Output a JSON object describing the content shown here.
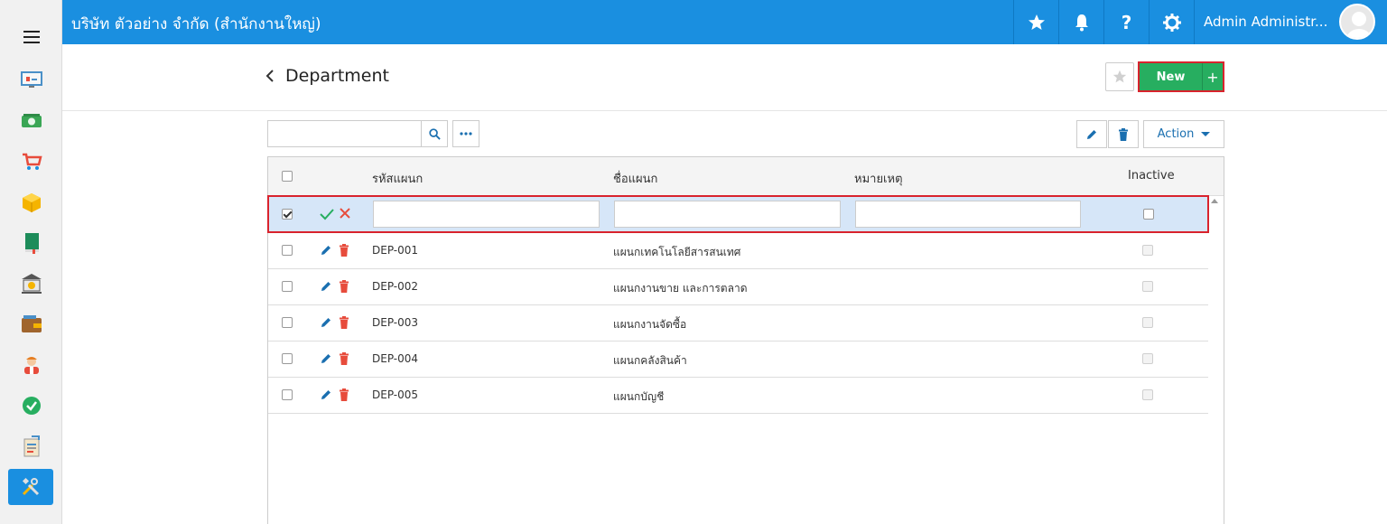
{
  "header": {
    "company": "บริษัท ตัวอย่าง จำกัด (สำนักงานใหญ่)",
    "user_name": "Admin Administr...",
    "icons": [
      "star-icon",
      "bell-icon",
      "help-icon",
      "gear-icon"
    ]
  },
  "sidebar": {
    "items": [
      "dashboard-icon",
      "money-icon",
      "cart-icon",
      "box-icon",
      "book-icon",
      "bank-icon",
      "wallet-icon",
      "people-icon",
      "approve-icon",
      "document-icon",
      "tools-icon"
    ],
    "active": "tools-icon"
  },
  "page": {
    "title": "Department",
    "new_label": "New",
    "plus_label": "+",
    "action_label": "Action"
  },
  "table": {
    "columns": [
      "รหัสแผนก",
      "ชื่อแผนก",
      "หมายเหตุ",
      "Inactive"
    ],
    "rows": [
      {
        "code": "DEP-001",
        "name": "แผนกเทคโนโลยีสารสนเทศ",
        "note": ""
      },
      {
        "code": "DEP-002",
        "name": "แผนกงานขาย และการตลาด",
        "note": ""
      },
      {
        "code": "DEP-003",
        "name": "แผนกงานจัดซื้อ",
        "note": ""
      },
      {
        "code": "DEP-004",
        "name": "แผนกคลังสินค้า",
        "note": ""
      },
      {
        "code": "DEP-005",
        "name": "แผนกบัญชี",
        "note": ""
      }
    ]
  },
  "colors": {
    "primary": "#1a8fe0",
    "success": "#27ae60",
    "danger": "#d9232d",
    "edit_row_bg": "#d6e6f8"
  }
}
